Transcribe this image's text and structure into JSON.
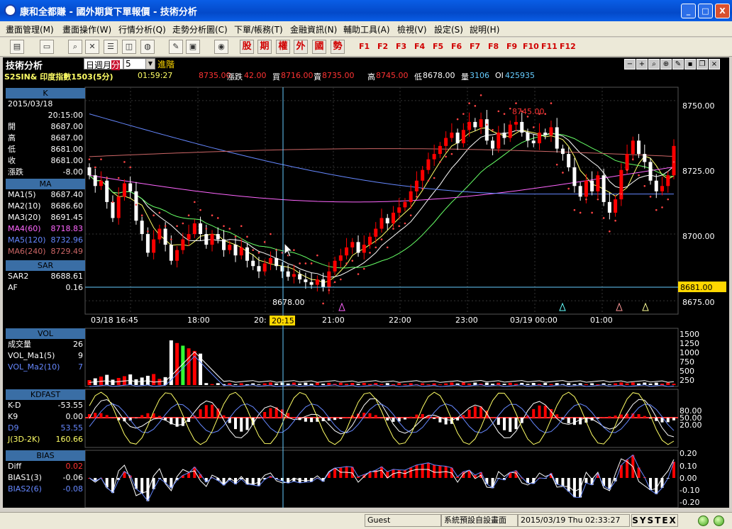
{
  "window": {
    "title": "康和全都賺 - 國外期貨下單報價 - 技術分析",
    "buttons": {
      "minimize": "_",
      "maximize": "□",
      "close": "X"
    }
  },
  "menu": [
    "畫面管理(M)",
    "畫面操作(W)",
    "行情分析(Q)",
    "走勢分析圖(C)",
    "下單/帳務(T)",
    "金融資訊(N)",
    "輔助工具(A)",
    "檢視(V)",
    "設定(S)",
    "說明(H)"
  ],
  "toolbar": {
    "quick_buttons": [
      "股",
      "期",
      "權",
      "外",
      "國",
      "勢"
    ],
    "function_keys": [
      "F1",
      "F2",
      "F3",
      "F4",
      "F5",
      "F6",
      "F7",
      "F8",
      "F9",
      "F10",
      "F11",
      "F12"
    ]
  },
  "chart_header": {
    "label": "技術分析",
    "period_options": [
      "日",
      "週",
      "月",
      "分"
    ],
    "period_selected": "分",
    "interval": "5",
    "advanced": "進階"
  },
  "quote": {
    "symbol": "S2SIN& 印度指數1503(5分)",
    "time": "01:59:27",
    "last": "8735.00",
    "change_label": "漲跌",
    "change": "42.00",
    "bid_label": "買",
    "bid": "8716.00",
    "ask_label": "賣",
    "ask": "8735.00",
    "high_label": "高",
    "high": "8745.00",
    "low_label": "低",
    "low": "8678.00",
    "vol_label": "量",
    "vol": "3106",
    "oi_label": "OI",
    "oi": "425935"
  },
  "panels": {
    "k": {
      "title": "K",
      "date": "2015/03/18",
      "time": "20:15:00",
      "rows": [
        {
          "k": "開",
          "v": "8687.00"
        },
        {
          "k": "高",
          "v": "8687.00"
        },
        {
          "k": "低",
          "v": "8681.00"
        },
        {
          "k": "收",
          "v": "8681.00"
        },
        {
          "k": "漲跌",
          "v": "-8.00"
        }
      ]
    },
    "ma": {
      "title": "MA",
      "rows": [
        {
          "k": "MA1(5)",
          "v": "8687.40",
          "color": "#ffffff"
        },
        {
          "k": "MA2(10)",
          "v": "8686.60",
          "color": "#ffffff"
        },
        {
          "k": "MA3(20)",
          "v": "8691.45",
          "color": "#ffffff"
        },
        {
          "k": "MA4(60)",
          "v": "8718.83",
          "color": "#ff66ff"
        },
        {
          "k": "MA5(120)",
          "v": "8732.96",
          "color": "#6688ff"
        },
        {
          "k": "MA6(240)",
          "v": "8729.49",
          "color": "#cc6666"
        }
      ]
    },
    "sar": {
      "title": "SAR",
      "rows": [
        {
          "k": "SAR2",
          "v": "8688.61"
        },
        {
          "k": "AF",
          "v": "0.16"
        }
      ]
    },
    "vol": {
      "title": "VOL",
      "rows": [
        {
          "k": "成交量",
          "v": "26",
          "color": "#ffffff"
        },
        {
          "k": "VOL_Ma1(5)",
          "v": "9",
          "color": "#ffffff"
        },
        {
          "k": "VOL_Ma2(10)",
          "v": "7",
          "color": "#6688ff"
        }
      ]
    },
    "kd": {
      "title": "KDFAST",
      "rows": [
        {
          "k": "K-D",
          "v": "-53.55",
          "color": "#ffffff"
        },
        {
          "k": "K9",
          "v": "0.00",
          "color": "#ffffff"
        },
        {
          "k": "D9",
          "v": "53.55",
          "color": "#6688ff"
        },
        {
          "k": "J(3D-2K)",
          "v": "160.66",
          "color": "#ffff66"
        }
      ]
    },
    "bias": {
      "title": "BIAS",
      "rows": [
        {
          "k": "Diff",
          "v": "0.02",
          "color": "#ff3333"
        },
        {
          "k": "BIAS1(3)",
          "v": "-0.06",
          "color": "#ffffff"
        },
        {
          "k": "BIAS2(6)",
          "v": "-0.08",
          "color": "#6688ff"
        }
      ]
    }
  },
  "price_axis": {
    "ticks": [
      "8750.00",
      "8725.00",
      "8700.00",
      "8675.00"
    ],
    "cursor_price": "8681.00",
    "high_label": "8745.00",
    "low_label": "8678.00"
  },
  "time_axis": {
    "labels": [
      "03/18 16:45",
      "18:00",
      "20:",
      "21:00",
      "22:00",
      "23:00",
      "03/19 00:00",
      "01:00"
    ],
    "cursor_time": "20:15"
  },
  "vol_axis": [
    "1500",
    "1250",
    "1000",
    "750",
    "500",
    "250"
  ],
  "kd_axis": [
    "80.00",
    "50.00",
    "20.00"
  ],
  "bias_axis": [
    "0.20",
    "0.10",
    "0.00",
    "-0.10",
    "-0.20"
  ],
  "statusbar": {
    "user": "Guest",
    "layout": "系統預設自設畫面",
    "datetime": "2015/03/19 Thu 02:33:27",
    "brand": "SYSTEX"
  },
  "colors": {
    "up": "#ff0000",
    "down": "#ffffff",
    "ma5": "#ffff66",
    "ma10": "#ffffff",
    "ma20": "#66ff66",
    "ma60": "#ff66ff",
    "ma120": "#6688ff",
    "ma240": "#cc6666",
    "sar": "#ff4444",
    "cursor": "#66ccff",
    "panel_header": "#3a6ea5"
  },
  "chart_data": {
    "type": "candlestick",
    "ylim": [
      8670,
      8755
    ],
    "series_names": [
      "MA1(5)",
      "MA2(10)",
      "MA3(20)",
      "MA4(60)",
      "MA5(120)",
      "MA6(240)"
    ],
    "close": [
      8722,
      8718,
      8720,
      8712,
      8706,
      8714,
      8719,
      8716,
      8705,
      8700,
      8693,
      8698,
      8702,
      8696,
      8690,
      8694,
      8698,
      8700,
      8704,
      8700,
      8696,
      8700,
      8698,
      8694,
      8696,
      8692,
      8695,
      8690,
      8688,
      8686,
      8689,
      8691,
      8688,
      8686,
      8684,
      8685,
      8683,
      8682,
      8681,
      8683,
      8680,
      8686,
      8690,
      8692,
      8695,
      8697,
      8693,
      8696,
      8699,
      8702,
      8706,
      8704,
      8708,
      8710,
      8712,
      8716,
      8720,
      8724,
      8728,
      8730,
      8733,
      8736,
      8738,
      8734,
      8739,
      8742,
      8740,
      8743,
      8735,
      8732,
      8738,
      8736,
      8741,
      8742,
      8738,
      8735,
      8734,
      8738,
      8737,
      8740,
      8732,
      8730,
      8725,
      8718,
      8714,
      8720,
      8716,
      8722,
      8712,
      8708,
      8713,
      8724,
      8730,
      8735,
      8730,
      8727,
      8720,
      8716,
      8718,
      8722,
      8733
    ]
  }
}
